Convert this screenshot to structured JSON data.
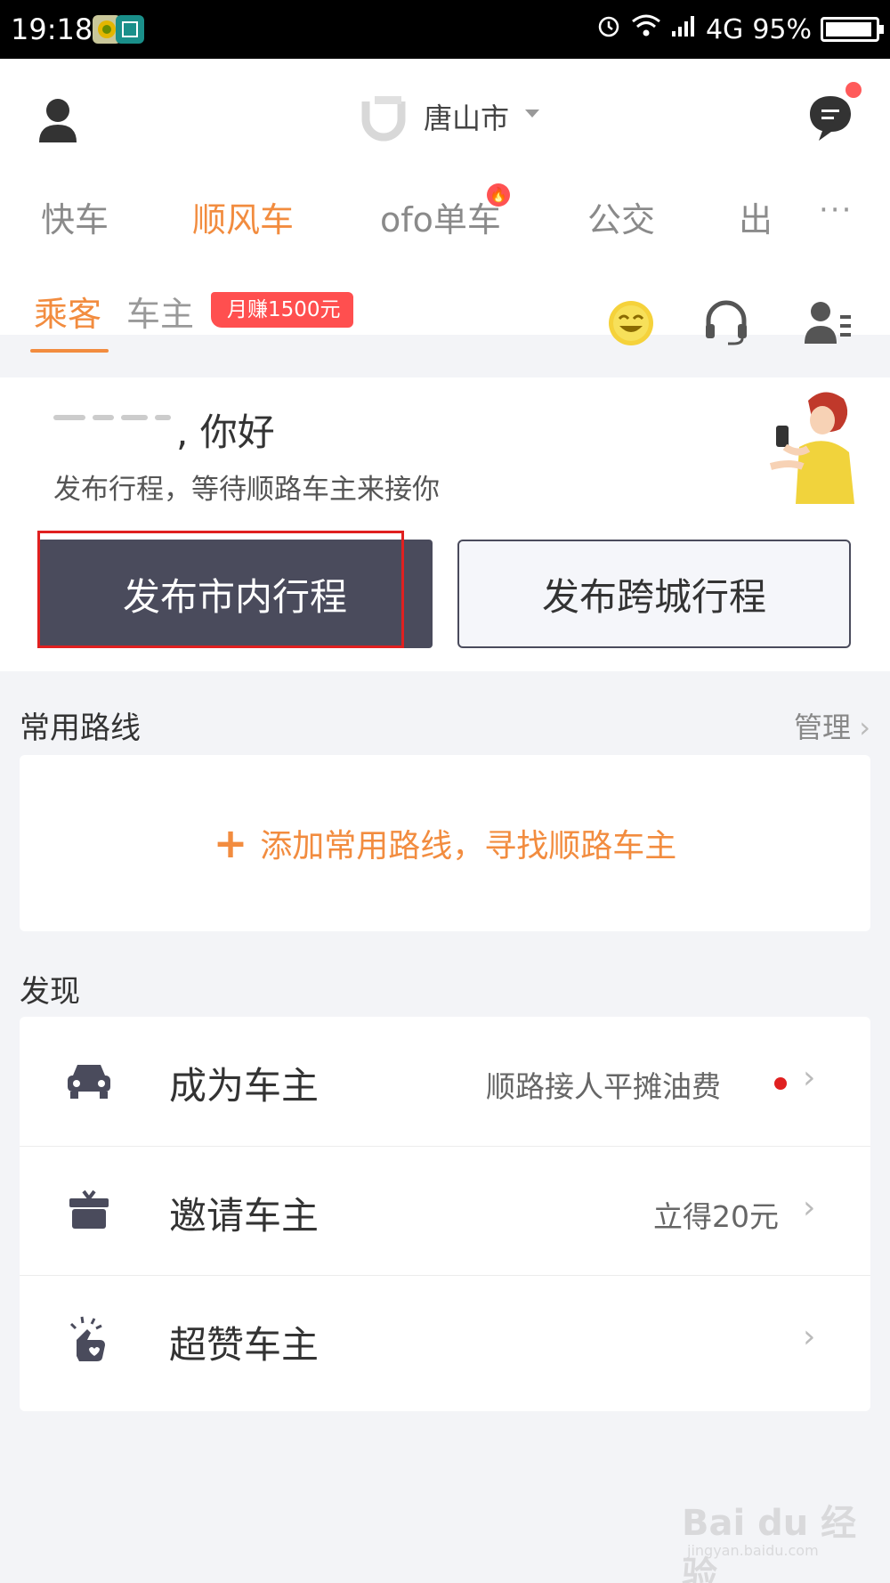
{
  "status_bar": {
    "time": "19:18",
    "network": "4G",
    "battery": "95%",
    "battery_level": 0.95
  },
  "header": {
    "city": "唐山市",
    "has_unread": true
  },
  "service_tabs": [
    {
      "label": "快车",
      "active": false
    },
    {
      "label": "顺风车",
      "active": true
    },
    {
      "label": "ofo单车",
      "active": false,
      "hot": true
    },
    {
      "label": "公交",
      "active": false
    },
    {
      "label": "出",
      "active": false
    }
  ],
  "more_label": "···",
  "roles": {
    "passenger": "乘客",
    "driver": "车主",
    "earn_badge": "月赚1500元"
  },
  "greeting": {
    "hello": ", 你好",
    "subtitle": "发布行程，等待顺路车主来接你",
    "btn_city": "发布市内行程",
    "btn_intercity": "发布跨城行程"
  },
  "routes": {
    "title": "常用路线",
    "manage": "管理",
    "add_plus": "+",
    "add_text": "添加常用路线，寻找顺路车主"
  },
  "discover": {
    "title": "发现",
    "items": [
      {
        "title": "成为车主",
        "note": "顺路接人平摊油费",
        "icon": "car-icon",
        "dot": true
      },
      {
        "title": "邀请车主",
        "note": "立得20元",
        "icon": "gift-icon",
        "dot": false
      },
      {
        "title": "超赞车主",
        "note": "",
        "icon": "thumbs-up-icon",
        "dot": false
      }
    ]
  },
  "chevron": "›",
  "watermark": {
    "main": "Bai du 经验",
    "sub": "jingyan.baidu.com"
  },
  "colors": {
    "accent": "#f28c3f",
    "dark_button": "#4a4b5c",
    "badge_red": "#ff4f4f",
    "highlight_border": "#e02020"
  }
}
